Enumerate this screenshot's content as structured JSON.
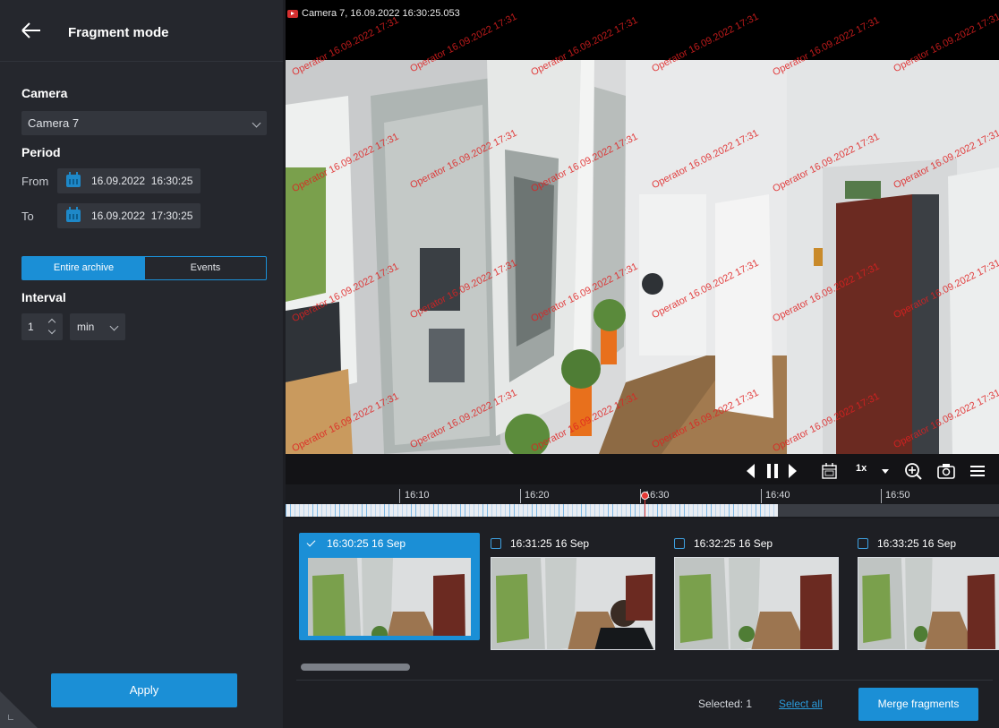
{
  "header": {
    "title": "Fragment mode",
    "back_icon": "arrow-left-icon"
  },
  "camera": {
    "label": "Camera",
    "selected": "Camera 7"
  },
  "period": {
    "label": "Period",
    "from_label": "From",
    "from_date": "16.09.2022",
    "from_time": "16:30:25",
    "to_label": "To",
    "to_date": "16.09.2022",
    "to_time": "17:30:25"
  },
  "mode_toggle": {
    "entire": "Entire archive",
    "events": "Events",
    "active": "entire"
  },
  "interval": {
    "label": "Interval",
    "value": "1",
    "unit": "min"
  },
  "apply_label": "Apply",
  "video": {
    "title": "Camera 7, 16.09.2022 16:30:25.053",
    "watermark": "Operator 16.09.2022 17:31",
    "speed": "1x"
  },
  "timeline": {
    "labels": [
      "16:10",
      "16:20",
      "16:30",
      "16:40",
      "16:50"
    ]
  },
  "fragments": [
    {
      "label": "16:30:25 16 Sep",
      "selected": true
    },
    {
      "label": "16:31:25 16 Sep",
      "selected": false
    },
    {
      "label": "16:32:25 16 Sep",
      "selected": false
    },
    {
      "label": "16:33:25 16 Sep",
      "selected": false
    }
  ],
  "footer": {
    "selected_text": "Selected: 1",
    "select_all": "Select all",
    "merge": "Merge fragments"
  },
  "colors": {
    "accent": "#1b8fd6",
    "panel": "#25272d",
    "background": "#1e1f24",
    "watermark": "#e02020"
  }
}
